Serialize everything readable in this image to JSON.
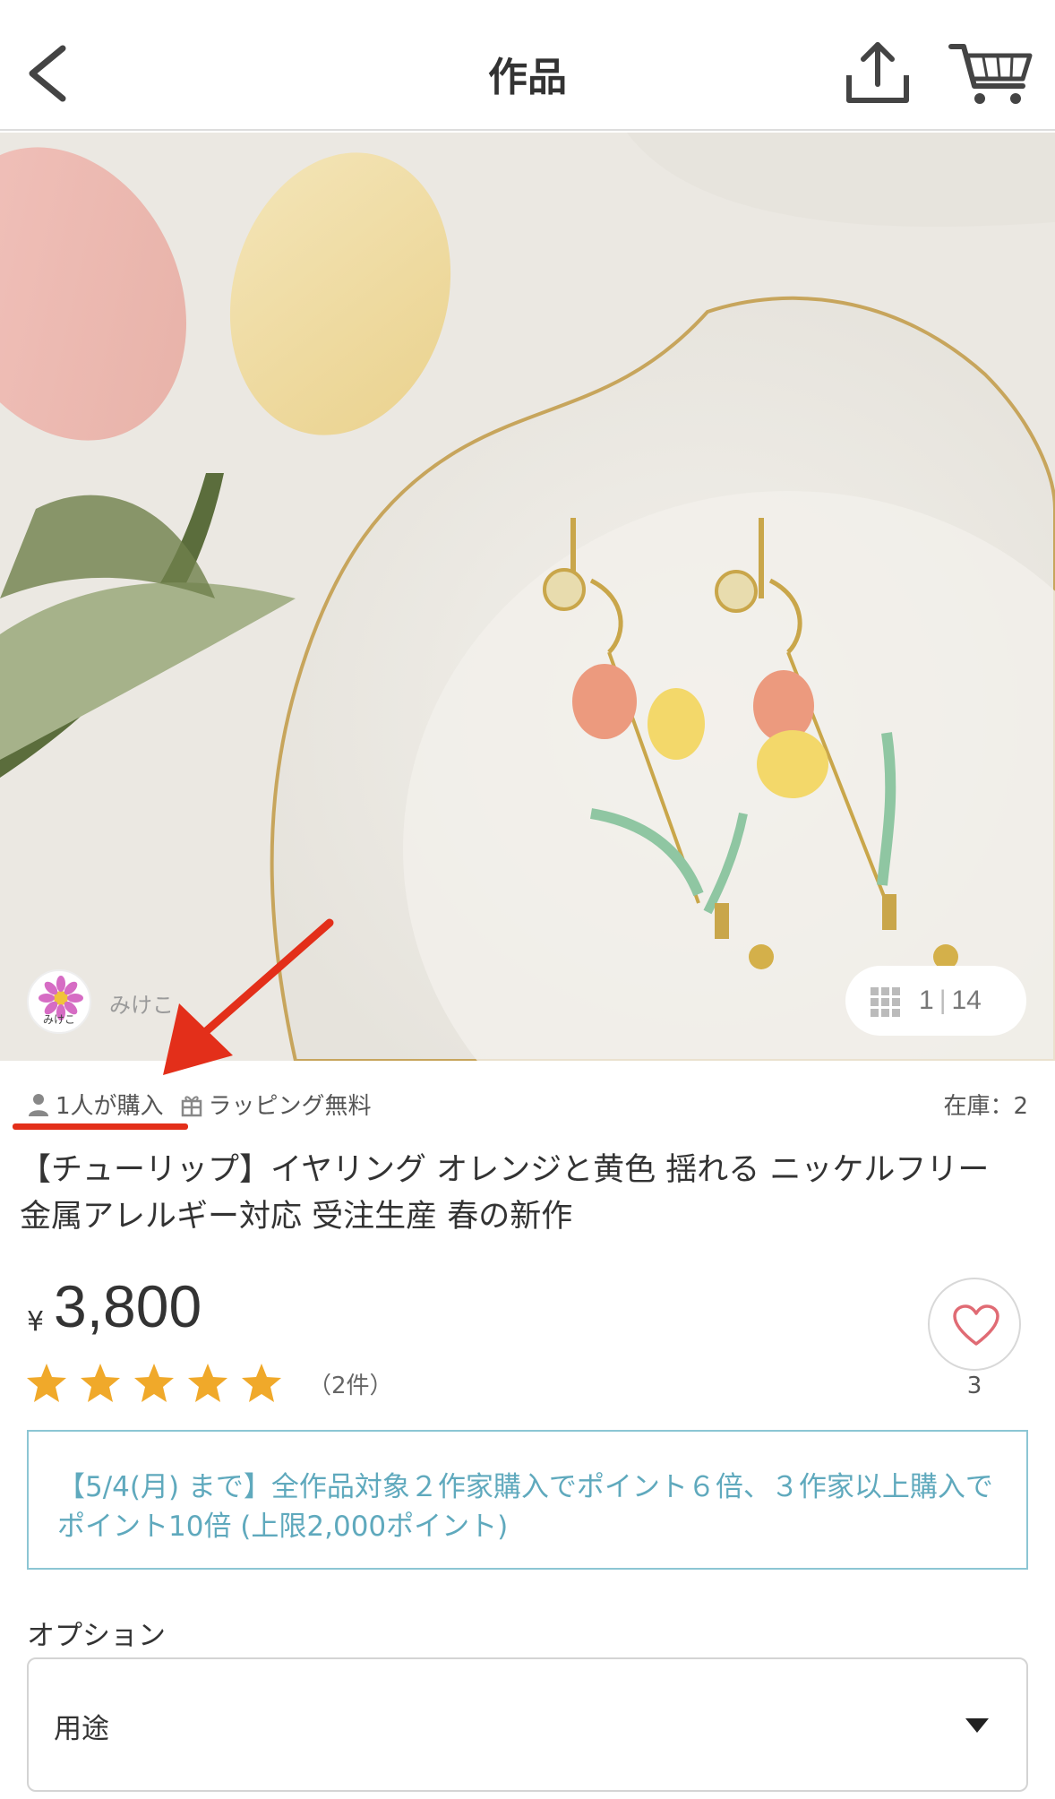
{
  "header": {
    "title": "作品"
  },
  "photo": {
    "shop_name": "みけこ",
    "shop_avatar_text": "みけこ",
    "image_index": "1",
    "image_total": "14"
  },
  "meta": {
    "purchased": "1人が購入",
    "wrapping": "ラッピング無料",
    "stock": "在庫：2"
  },
  "product": {
    "title": "【チューリップ】イヤリング オレンジと黄色 揺れる ニッケルフリー 金属アレルギー対応 受注生産 春の新作",
    "currency": "¥",
    "price": "3,800",
    "rating_stars": 5,
    "rating_count": "（2件）",
    "favorites": "3"
  },
  "promo": {
    "text": "【5/4(月) まで】全作品対象２作家購入でポイント６倍、３作家以上購入でポイント10倍 (上限2,000ポイント)"
  },
  "option": {
    "label": "オプション",
    "selected": "用途"
  },
  "colors": {
    "accent_promo": "#5fa9bd",
    "annotation_red": "#e32f1a",
    "star": "#f0a92a"
  }
}
